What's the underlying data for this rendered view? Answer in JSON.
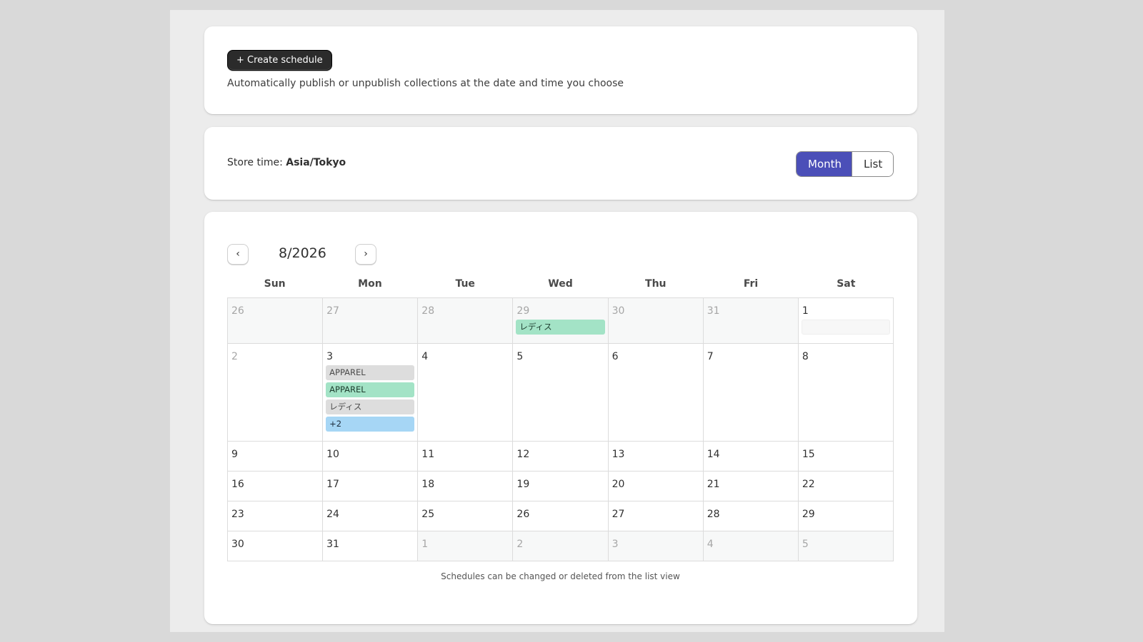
{
  "header": {
    "create_label": "+ Create schedule",
    "description": "Automatically publish or unpublish collections at the date and time you choose"
  },
  "store": {
    "label": "Store time: ",
    "timezone": "Asia/Tokyo",
    "view_month": "Month",
    "view_list": "List",
    "active_view": "Month",
    "accent_color": "#4b4fb8"
  },
  "calendar": {
    "prev_label": "‹",
    "next_label": "›",
    "month_label": "8/2026",
    "weekdays": [
      "Sun",
      "Mon",
      "Tue",
      "Wed",
      "Thu",
      "Fri",
      "Sat"
    ],
    "weeks": [
      [
        {
          "d": "26",
          "other": true,
          "events": []
        },
        {
          "d": "27",
          "other": true,
          "events": []
        },
        {
          "d": "28",
          "other": true,
          "events": []
        },
        {
          "d": "29",
          "other": true,
          "events": [
            {
              "label": "レディス",
              "color": "green"
            }
          ]
        },
        {
          "d": "30",
          "other": true,
          "events": []
        },
        {
          "d": "31",
          "other": true,
          "events": []
        },
        {
          "d": "1",
          "other": false,
          "events": [
            {
              "label": "",
              "color": "ghost"
            }
          ]
        }
      ],
      [
        {
          "d": "2",
          "other": false,
          "dim": true,
          "events": []
        },
        {
          "d": "3",
          "other": false,
          "events": [
            {
              "label": "APPAREL",
              "color": "gray"
            },
            {
              "label": "APPAREL",
              "color": "green"
            },
            {
              "label": "レディス",
              "color": "gray"
            },
            {
              "label": "+2",
              "color": "blue"
            }
          ]
        },
        {
          "d": "4",
          "other": false,
          "events": []
        },
        {
          "d": "5",
          "other": false,
          "events": []
        },
        {
          "d": "6",
          "other": false,
          "events": []
        },
        {
          "d": "7",
          "other": false,
          "events": []
        },
        {
          "d": "8",
          "other": false,
          "events": []
        }
      ],
      [
        {
          "d": "9",
          "other": false,
          "events": []
        },
        {
          "d": "10",
          "other": false,
          "events": []
        },
        {
          "d": "11",
          "other": false,
          "events": []
        },
        {
          "d": "12",
          "other": false,
          "events": []
        },
        {
          "d": "13",
          "other": false,
          "events": []
        },
        {
          "d": "14",
          "other": false,
          "events": []
        },
        {
          "d": "15",
          "other": false,
          "events": []
        }
      ],
      [
        {
          "d": "16",
          "other": false,
          "events": []
        },
        {
          "d": "17",
          "other": false,
          "events": []
        },
        {
          "d": "18",
          "other": false,
          "events": []
        },
        {
          "d": "19",
          "other": false,
          "events": []
        },
        {
          "d": "20",
          "other": false,
          "events": []
        },
        {
          "d": "21",
          "other": false,
          "events": []
        },
        {
          "d": "22",
          "other": false,
          "events": []
        }
      ],
      [
        {
          "d": "23",
          "other": false,
          "events": []
        },
        {
          "d": "24",
          "other": false,
          "events": []
        },
        {
          "d": "25",
          "other": false,
          "events": []
        },
        {
          "d": "26",
          "other": false,
          "events": []
        },
        {
          "d": "27",
          "other": false,
          "events": []
        },
        {
          "d": "28",
          "other": false,
          "events": []
        },
        {
          "d": "29",
          "other": false,
          "events": []
        }
      ],
      [
        {
          "d": "30",
          "other": false,
          "events": []
        },
        {
          "d": "31",
          "other": false,
          "events": []
        },
        {
          "d": "1",
          "other": true,
          "events": []
        },
        {
          "d": "2",
          "other": true,
          "events": []
        },
        {
          "d": "3",
          "other": true,
          "events": []
        },
        {
          "d": "4",
          "other": true,
          "events": []
        },
        {
          "d": "5",
          "other": true,
          "events": []
        }
      ]
    ],
    "footer_note": "Schedules can be changed or deleted from the list view"
  }
}
